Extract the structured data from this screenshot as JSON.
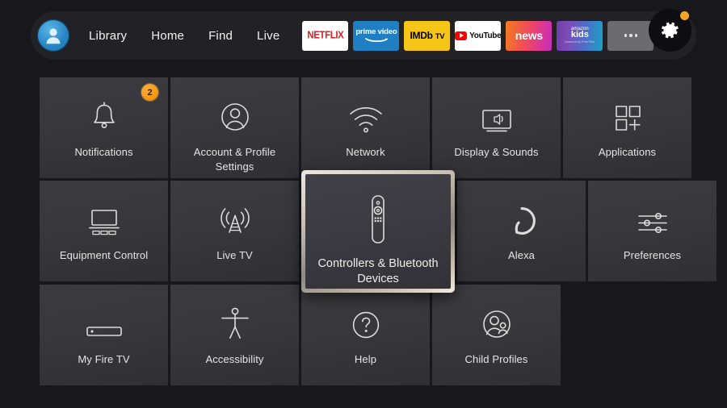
{
  "nav": {
    "avatar_label": "profile-avatar",
    "links": [
      {
        "label": "Library"
      },
      {
        "label": "Home"
      },
      {
        "label": "Find"
      },
      {
        "label": "Live"
      }
    ],
    "apps": [
      {
        "id": "netflix",
        "label": "NETFLIX"
      },
      {
        "id": "prime-video",
        "label": "prime video"
      },
      {
        "id": "imdb-tv",
        "label": "IMDb",
        "suffix": "TV"
      },
      {
        "id": "youtube",
        "label": "YouTube"
      },
      {
        "id": "news",
        "label": "news"
      },
      {
        "id": "amazon-kids",
        "label_top": "amazon",
        "label_main": "kids",
        "label_sub": "powered by FreeTime"
      },
      {
        "id": "more",
        "label": "More apps"
      }
    ],
    "settings_button": {
      "label": "Settings",
      "badge_visible": true,
      "badge_color": "#f5a623"
    }
  },
  "settings_grid": {
    "rows": [
      [
        {
          "label": "Notifications",
          "icon": "bell-icon",
          "badge": "2"
        },
        {
          "label": "Account & Profile Settings",
          "icon": "account-icon"
        },
        {
          "label": "Network",
          "icon": "wifi-icon"
        },
        {
          "label": "Display & Sounds",
          "icon": "display-sound-icon"
        },
        {
          "label": "Applications",
          "icon": "applications-icon"
        }
      ],
      [
        {
          "label": "Equipment Control",
          "icon": "equipment-control-icon"
        },
        {
          "label": "Live TV",
          "icon": "antenna-icon"
        },
        {
          "label": "Controllers & Bluetooth Devices",
          "icon": "remote-icon",
          "selected": true
        },
        {
          "label": "Alexa",
          "icon": "alexa-icon"
        },
        {
          "label": "Preferences",
          "icon": "sliders-icon"
        }
      ],
      [
        {
          "label": "My Fire TV",
          "icon": "firetv-stick-icon"
        },
        {
          "label": "Accessibility",
          "icon": "accessibility-icon"
        },
        {
          "label": "Help",
          "icon": "question-circle-icon"
        },
        {
          "label": "Child Profiles",
          "icon": "child-profiles-icon"
        }
      ]
    ]
  },
  "colors": {
    "page_background": "#17171c",
    "tile_background": "#37373c",
    "accent_orange": "#f5a623",
    "selection_border": "#e5dfd2",
    "text_primary": "#e6e6e6"
  }
}
